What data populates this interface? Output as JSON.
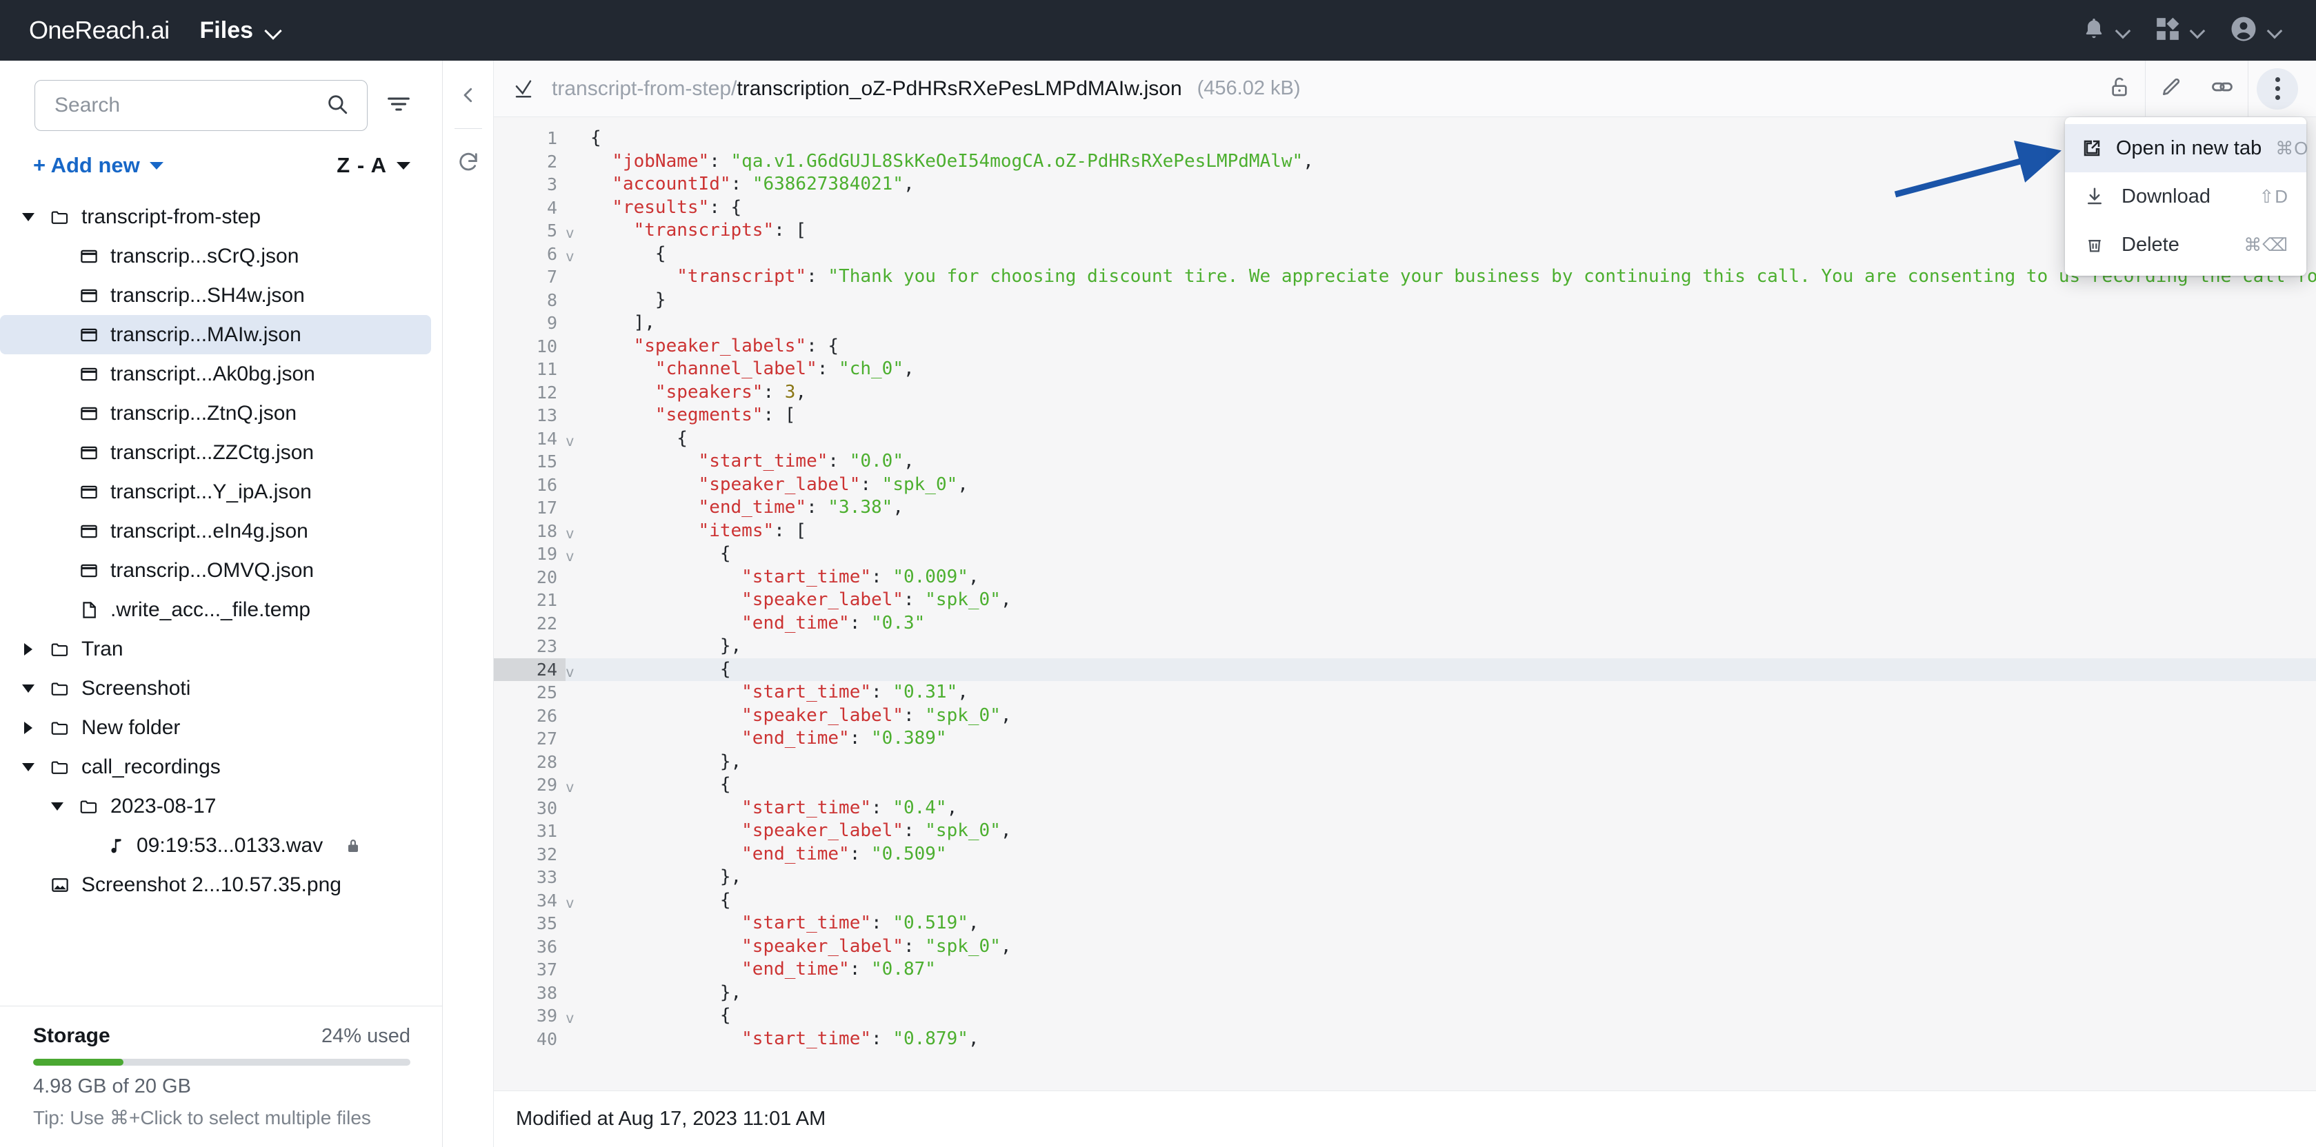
{
  "topbar": {
    "logo_text": "OneReach.ai",
    "app_name": "Files",
    "icons": {
      "notifications": "bell-icon",
      "apps": "apps-grid-icon",
      "account": "user-avatar-icon"
    }
  },
  "sidebar": {
    "search": {
      "value": "",
      "placeholder": "Search"
    },
    "filter_icon": "filter-icon",
    "add_new_label": "+ Add new",
    "sort_label": "Z - A",
    "tree": [
      {
        "label": "transcript-from-step",
        "type": "folder",
        "depth": 0,
        "twisty": "down",
        "selected": false,
        "locked": false
      },
      {
        "label": "transcrip...sCrQ.json",
        "type": "json",
        "depth": 1,
        "twisty": "none",
        "selected": false,
        "locked": false
      },
      {
        "label": "transcrip...SH4w.json",
        "type": "json",
        "depth": 1,
        "twisty": "none",
        "selected": false,
        "locked": false
      },
      {
        "label": "transcrip...MAIw.json",
        "type": "json",
        "depth": 1,
        "twisty": "none",
        "selected": true,
        "locked": false
      },
      {
        "label": "transcript...Ak0bg.json",
        "type": "json",
        "depth": 1,
        "twisty": "none",
        "selected": false,
        "locked": false
      },
      {
        "label": "transcrip...ZtnQ.json",
        "type": "json",
        "depth": 1,
        "twisty": "none",
        "selected": false,
        "locked": false
      },
      {
        "label": "transcript...ZZCtg.json",
        "type": "json",
        "depth": 1,
        "twisty": "none",
        "selected": false,
        "locked": false
      },
      {
        "label": "transcript...Y_ipA.json",
        "type": "json",
        "depth": 1,
        "twisty": "none",
        "selected": false,
        "locked": false
      },
      {
        "label": "transcript...eIn4g.json",
        "type": "json",
        "depth": 1,
        "twisty": "none",
        "selected": false,
        "locked": false
      },
      {
        "label": "transcrip...OMVQ.json",
        "type": "json",
        "depth": 1,
        "twisty": "none",
        "selected": false,
        "locked": false
      },
      {
        "label": ".write_acc..._file.temp",
        "type": "file",
        "depth": 1,
        "twisty": "none",
        "selected": false,
        "locked": false
      },
      {
        "label": "Tran",
        "type": "folder",
        "depth": 0,
        "twisty": "right",
        "selected": false,
        "locked": false
      },
      {
        "label": "Screenshoti",
        "type": "folder",
        "depth": 0,
        "twisty": "down",
        "selected": false,
        "locked": false
      },
      {
        "label": "New folder",
        "type": "folder",
        "depth": 0,
        "twisty": "right",
        "selected": false,
        "locked": false
      },
      {
        "label": "call_recordings",
        "type": "folder",
        "depth": 0,
        "twisty": "down",
        "selected": false,
        "locked": false
      },
      {
        "label": "2023-08-17",
        "type": "folder",
        "depth": 1,
        "twisty": "down",
        "selected": false,
        "locked": false
      },
      {
        "label": "09:19:53...0133.wav",
        "type": "audio",
        "depth": 2,
        "twisty": "none",
        "selected": false,
        "locked": true
      },
      {
        "label": "Screenshot 2...10.57.35.png",
        "type": "image",
        "depth": 0,
        "twisty": "none",
        "selected": false,
        "locked": false
      }
    ],
    "storage": {
      "title": "Storage",
      "percent_label": "24% used",
      "percent_value": 24,
      "usage_label": "4.98 GB of 20 GB",
      "tip": "Tip: Use ⌘+Click to select multiple files",
      "bar_color": "#4aa832"
    }
  },
  "rail": {
    "collapse_icon": "chevron-left-icon",
    "refresh_icon": "refresh-icon"
  },
  "viewer": {
    "header": {
      "path_prefix": "transcript-from-step/",
      "file_name": "transcription_oZ-PdHRsRXePesLMPdMAIw.json",
      "file_size": "(456.02 kB)",
      "select_icon": "select-check-icon",
      "lock_icon": "unlock-icon",
      "edit_icon": "pencil-icon",
      "link_icon": "link-icon",
      "more_icon": "kebab-menu-icon"
    },
    "menu": {
      "items": [
        {
          "label": "Open in new tab",
          "shortcut": "⌘O",
          "icon": "external-link-icon",
          "active": true
        },
        {
          "label": "Download",
          "shortcut": "⇧D",
          "icon": "download-icon",
          "active": false
        },
        {
          "label": "Delete",
          "shortcut": "⌘⌫",
          "icon": "trash-icon",
          "active": false
        }
      ]
    },
    "footer": {
      "modified": "Modified at Aug 17, 2023 11:01 AM"
    },
    "annotation": {
      "type": "arrow",
      "color": "#1a54a8"
    },
    "code": {
      "highlighted_line": 24,
      "lines": [
        {
          "n": 1,
          "fold": "",
          "tokens": [
            {
              "t": "p",
              "v": "{"
            }
          ]
        },
        {
          "n": 2,
          "fold": "",
          "tokens": [
            {
              "t": "p",
              "v": "  "
            },
            {
              "t": "k",
              "v": "\"jobName\""
            },
            {
              "t": "p",
              "v": ": "
            },
            {
              "t": "s",
              "v": "\"qa.v1.G6dGUJL8SkKeOeI54mogCA.oZ-PdHRsRXePesLMPdMAlw\""
            },
            {
              "t": "p",
              "v": ","
            }
          ]
        },
        {
          "n": 3,
          "fold": "",
          "tokens": [
            {
              "t": "p",
              "v": "  "
            },
            {
              "t": "k",
              "v": "\"accountId\""
            },
            {
              "t": "p",
              "v": ": "
            },
            {
              "t": "s",
              "v": "\"638627384021\""
            },
            {
              "t": "p",
              "v": ","
            }
          ]
        },
        {
          "n": 4,
          "fold": "",
          "tokens": [
            {
              "t": "p",
              "v": "  "
            },
            {
              "t": "k",
              "v": "\"results\""
            },
            {
              "t": "p",
              "v": ": {"
            }
          ]
        },
        {
          "n": 5,
          "fold": "v",
          "tokens": [
            {
              "t": "p",
              "v": "    "
            },
            {
              "t": "k",
              "v": "\"transcripts\""
            },
            {
              "t": "p",
              "v": ": ["
            }
          ]
        },
        {
          "n": 6,
          "fold": "v",
          "tokens": [
            {
              "t": "p",
              "v": "      {"
            }
          ]
        },
        {
          "n": 7,
          "fold": "",
          "tokens": [
            {
              "t": "p",
              "v": "        "
            },
            {
              "t": "k",
              "v": "\"transcript\""
            },
            {
              "t": "p",
              "v": ": "
            },
            {
              "t": "s",
              "v": "\"Thank you for choosing discount tire. We appreciate your business by continuing this call. You are consenting to us recording the call for quality and tr"
            }
          ]
        },
        {
          "n": 8,
          "fold": "",
          "tokens": [
            {
              "t": "p",
              "v": "      }"
            }
          ]
        },
        {
          "n": 9,
          "fold": "",
          "tokens": [
            {
              "t": "p",
              "v": "    ],"
            }
          ]
        },
        {
          "n": 10,
          "fold": "",
          "tokens": [
            {
              "t": "p",
              "v": "    "
            },
            {
              "t": "k",
              "v": "\"speaker_labels\""
            },
            {
              "t": "p",
              "v": ": {"
            }
          ]
        },
        {
          "n": 11,
          "fold": "",
          "tokens": [
            {
              "t": "p",
              "v": "      "
            },
            {
              "t": "k",
              "v": "\"channel_label\""
            },
            {
              "t": "p",
              "v": ": "
            },
            {
              "t": "s",
              "v": "\"ch_0\""
            },
            {
              "t": "p",
              "v": ","
            }
          ]
        },
        {
          "n": 12,
          "fold": "",
          "tokens": [
            {
              "t": "p",
              "v": "      "
            },
            {
              "t": "k",
              "v": "\"speakers\""
            },
            {
              "t": "p",
              "v": ": "
            },
            {
              "t": "n",
              "v": "3"
            },
            {
              "t": "p",
              "v": ","
            }
          ]
        },
        {
          "n": 13,
          "fold": "",
          "tokens": [
            {
              "t": "p",
              "v": "      "
            },
            {
              "t": "k",
              "v": "\"segments\""
            },
            {
              "t": "p",
              "v": ": ["
            }
          ]
        },
        {
          "n": 14,
          "fold": "v",
          "tokens": [
            {
              "t": "p",
              "v": "        {"
            }
          ]
        },
        {
          "n": 15,
          "fold": "",
          "tokens": [
            {
              "t": "p",
              "v": "          "
            },
            {
              "t": "k",
              "v": "\"start_time\""
            },
            {
              "t": "p",
              "v": ": "
            },
            {
              "t": "s",
              "v": "\"0.0\""
            },
            {
              "t": "p",
              "v": ","
            }
          ]
        },
        {
          "n": 16,
          "fold": "",
          "tokens": [
            {
              "t": "p",
              "v": "          "
            },
            {
              "t": "k",
              "v": "\"speaker_label\""
            },
            {
              "t": "p",
              "v": ": "
            },
            {
              "t": "s",
              "v": "\"spk_0\""
            },
            {
              "t": "p",
              "v": ","
            }
          ]
        },
        {
          "n": 17,
          "fold": "",
          "tokens": [
            {
              "t": "p",
              "v": "          "
            },
            {
              "t": "k",
              "v": "\"end_time\""
            },
            {
              "t": "p",
              "v": ": "
            },
            {
              "t": "s",
              "v": "\"3.38\""
            },
            {
              "t": "p",
              "v": ","
            }
          ]
        },
        {
          "n": 18,
          "fold": "v",
          "tokens": [
            {
              "t": "p",
              "v": "          "
            },
            {
              "t": "k",
              "v": "\"items\""
            },
            {
              "t": "p",
              "v": ": ["
            }
          ]
        },
        {
          "n": 19,
          "fold": "v",
          "tokens": [
            {
              "t": "p",
              "v": "            {"
            }
          ]
        },
        {
          "n": 20,
          "fold": "",
          "tokens": [
            {
              "t": "p",
              "v": "              "
            },
            {
              "t": "k",
              "v": "\"start_time\""
            },
            {
              "t": "p",
              "v": ": "
            },
            {
              "t": "s",
              "v": "\"0.009\""
            },
            {
              "t": "p",
              "v": ","
            }
          ]
        },
        {
          "n": 21,
          "fold": "",
          "tokens": [
            {
              "t": "p",
              "v": "              "
            },
            {
              "t": "k",
              "v": "\"speaker_label\""
            },
            {
              "t": "p",
              "v": ": "
            },
            {
              "t": "s",
              "v": "\"spk_0\""
            },
            {
              "t": "p",
              "v": ","
            }
          ]
        },
        {
          "n": 22,
          "fold": "",
          "tokens": [
            {
              "t": "p",
              "v": "              "
            },
            {
              "t": "k",
              "v": "\"end_time\""
            },
            {
              "t": "p",
              "v": ": "
            },
            {
              "t": "s",
              "v": "\"0.3\""
            }
          ]
        },
        {
          "n": 23,
          "fold": "",
          "tokens": [
            {
              "t": "p",
              "v": "            },"
            }
          ]
        },
        {
          "n": 24,
          "fold": "v",
          "tokens": [
            {
              "t": "p",
              "v": "            {"
            }
          ]
        },
        {
          "n": 25,
          "fold": "",
          "tokens": [
            {
              "t": "p",
              "v": "              "
            },
            {
              "t": "k",
              "v": "\"start_time\""
            },
            {
              "t": "p",
              "v": ": "
            },
            {
              "t": "s",
              "v": "\"0.31\""
            },
            {
              "t": "p",
              "v": ","
            }
          ]
        },
        {
          "n": 26,
          "fold": "",
          "tokens": [
            {
              "t": "p",
              "v": "              "
            },
            {
              "t": "k",
              "v": "\"speaker_label\""
            },
            {
              "t": "p",
              "v": ": "
            },
            {
              "t": "s",
              "v": "\"spk_0\""
            },
            {
              "t": "p",
              "v": ","
            }
          ]
        },
        {
          "n": 27,
          "fold": "",
          "tokens": [
            {
              "t": "p",
              "v": "              "
            },
            {
              "t": "k",
              "v": "\"end_time\""
            },
            {
              "t": "p",
              "v": ": "
            },
            {
              "t": "s",
              "v": "\"0.389\""
            }
          ]
        },
        {
          "n": 28,
          "fold": "",
          "tokens": [
            {
              "t": "p",
              "v": "            },"
            }
          ]
        },
        {
          "n": 29,
          "fold": "v",
          "tokens": [
            {
              "t": "p",
              "v": "            {"
            }
          ]
        },
        {
          "n": 30,
          "fold": "",
          "tokens": [
            {
              "t": "p",
              "v": "              "
            },
            {
              "t": "k",
              "v": "\"start_time\""
            },
            {
              "t": "p",
              "v": ": "
            },
            {
              "t": "s",
              "v": "\"0.4\""
            },
            {
              "t": "p",
              "v": ","
            }
          ]
        },
        {
          "n": 31,
          "fold": "",
          "tokens": [
            {
              "t": "p",
              "v": "              "
            },
            {
              "t": "k",
              "v": "\"speaker_label\""
            },
            {
              "t": "p",
              "v": ": "
            },
            {
              "t": "s",
              "v": "\"spk_0\""
            },
            {
              "t": "p",
              "v": ","
            }
          ]
        },
        {
          "n": 32,
          "fold": "",
          "tokens": [
            {
              "t": "p",
              "v": "              "
            },
            {
              "t": "k",
              "v": "\"end_time\""
            },
            {
              "t": "p",
              "v": ": "
            },
            {
              "t": "s",
              "v": "\"0.509\""
            }
          ]
        },
        {
          "n": 33,
          "fold": "",
          "tokens": [
            {
              "t": "p",
              "v": "            },"
            }
          ]
        },
        {
          "n": 34,
          "fold": "v",
          "tokens": [
            {
              "t": "p",
              "v": "            {"
            }
          ]
        },
        {
          "n": 35,
          "fold": "",
          "tokens": [
            {
              "t": "p",
              "v": "              "
            },
            {
              "t": "k",
              "v": "\"start_time\""
            },
            {
              "t": "p",
              "v": ": "
            },
            {
              "t": "s",
              "v": "\"0.519\""
            },
            {
              "t": "p",
              "v": ","
            }
          ]
        },
        {
          "n": 36,
          "fold": "",
          "tokens": [
            {
              "t": "p",
              "v": "              "
            },
            {
              "t": "k",
              "v": "\"speaker_label\""
            },
            {
              "t": "p",
              "v": ": "
            },
            {
              "t": "s",
              "v": "\"spk_0\""
            },
            {
              "t": "p",
              "v": ","
            }
          ]
        },
        {
          "n": 37,
          "fold": "",
          "tokens": [
            {
              "t": "p",
              "v": "              "
            },
            {
              "t": "k",
              "v": "\"end_time\""
            },
            {
              "t": "p",
              "v": ": "
            },
            {
              "t": "s",
              "v": "\"0.87\""
            }
          ]
        },
        {
          "n": 38,
          "fold": "",
          "tokens": [
            {
              "t": "p",
              "v": "            },"
            }
          ]
        },
        {
          "n": 39,
          "fold": "v",
          "tokens": [
            {
              "t": "p",
              "v": "            {"
            }
          ]
        },
        {
          "n": 40,
          "fold": "",
          "tokens": [
            {
              "t": "p",
              "v": "              "
            },
            {
              "t": "k",
              "v": "\"start_time\""
            },
            {
              "t": "p",
              "v": ": "
            },
            {
              "t": "s",
              "v": "\"0.879\""
            },
            {
              "t": "p",
              "v": ","
            }
          ]
        }
      ]
    }
  }
}
